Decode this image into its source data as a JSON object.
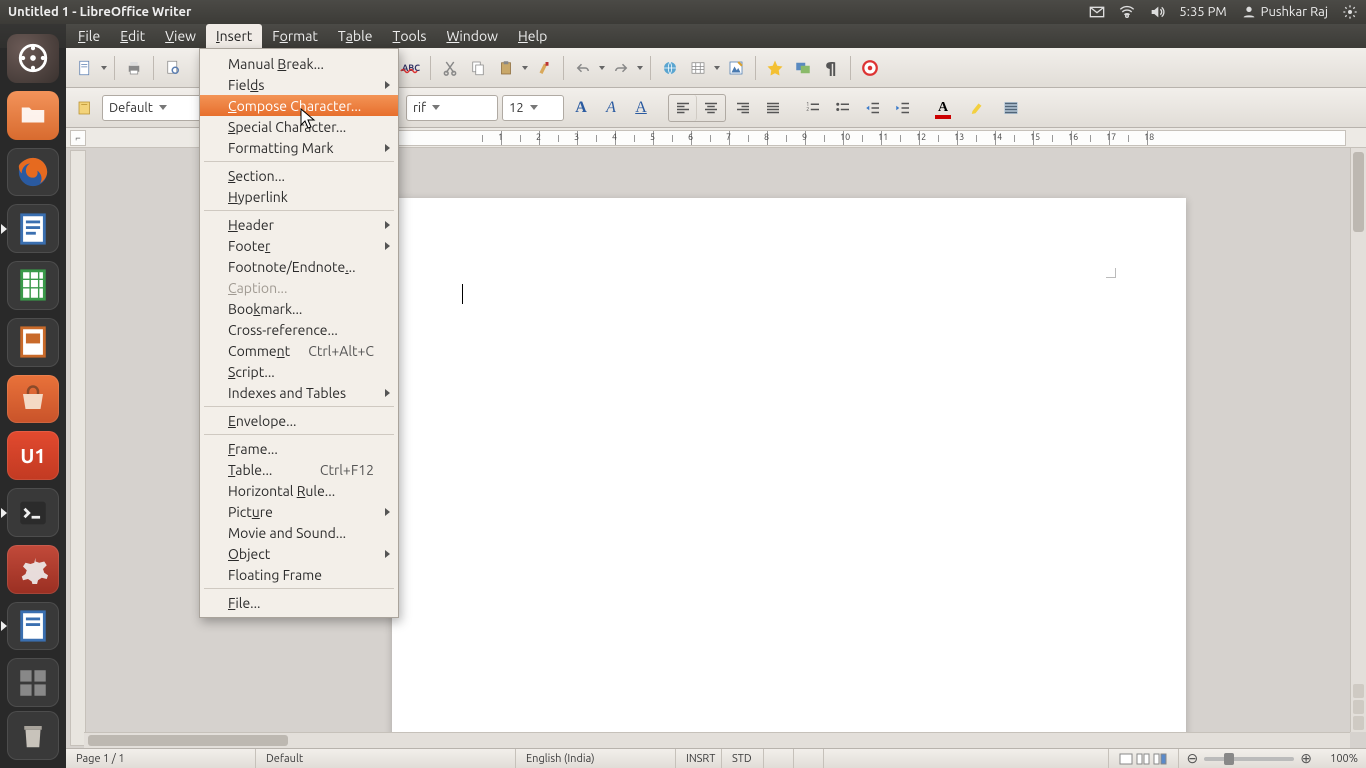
{
  "system": {
    "window_title": "Untitled 1 - LibreOffice Writer",
    "clock": "5:35 PM",
    "user": "Pushkar Raj"
  },
  "menubar": {
    "items": [
      {
        "label": "File",
        "mnemonic": "F"
      },
      {
        "label": "Edit",
        "mnemonic": "E"
      },
      {
        "label": "View",
        "mnemonic": "V"
      },
      {
        "label": "Insert",
        "mnemonic": "I",
        "open": true
      },
      {
        "label": "Format",
        "mnemonic": "o"
      },
      {
        "label": "Table",
        "mnemonic": "a"
      },
      {
        "label": "Tools",
        "mnemonic": "T"
      },
      {
        "label": "Window",
        "mnemonic": "W"
      },
      {
        "label": "Help",
        "mnemonic": "H"
      }
    ]
  },
  "insert_menu": {
    "groups": [
      [
        {
          "label": "Manual Break...",
          "mnemonic": "B"
        },
        {
          "label": "Fields",
          "mnemonic": "d",
          "submenu": true
        },
        {
          "label": "Compose Character...",
          "mnemonic": "C",
          "highlight": true
        },
        {
          "label": "Special Character...",
          "mnemonic": "S"
        },
        {
          "label": "Formatting Mark",
          "mnemonic": "g",
          "submenu": true
        }
      ],
      [
        {
          "label": "Section...",
          "mnemonic": "S"
        },
        {
          "label": "Hyperlink",
          "mnemonic": "H"
        }
      ],
      [
        {
          "label": "Header",
          "mnemonic": "H",
          "submenu": true
        },
        {
          "label": "Footer",
          "mnemonic": "r",
          "submenu": true
        },
        {
          "label": "Footnote/Endnote...",
          "mnemonic": "."
        },
        {
          "label": "Caption...",
          "mnemonic": "C",
          "disabled": true
        },
        {
          "label": "Bookmark...",
          "mnemonic": "k"
        },
        {
          "label": "Cross-reference..."
        },
        {
          "label": "Comment",
          "mnemonic": "n",
          "accel": "Ctrl+Alt+C"
        },
        {
          "label": "Script...",
          "mnemonic": "S"
        },
        {
          "label": "Indexes and Tables",
          "submenu": true
        }
      ],
      [
        {
          "label": "Envelope...",
          "mnemonic": "E"
        }
      ],
      [
        {
          "label": "Frame...",
          "mnemonic": "F"
        },
        {
          "label": "Table...",
          "mnemonic": "T",
          "accel": "Ctrl+F12"
        },
        {
          "label": "Horizontal Rule...",
          "mnemonic": "R"
        },
        {
          "label": "Picture",
          "mnemonic": "u",
          "submenu": true
        },
        {
          "label": "Movie and Sound..."
        },
        {
          "label": "Object",
          "mnemonic": "O",
          "submenu": true
        },
        {
          "label": "Floating Frame"
        }
      ],
      [
        {
          "label": "File...",
          "mnemonic": "F"
        }
      ]
    ]
  },
  "format": {
    "style": "Default",
    "font": "rif",
    "size": "12"
  },
  "status": {
    "page": "Page 1 / 1",
    "style": "Default",
    "language": "English (India)",
    "insert_mode": "INSRT",
    "selection_mode": "STD",
    "zoom": "100%"
  },
  "ruler": {
    "numbers": [
      1,
      2,
      3,
      4,
      5,
      6,
      7,
      8,
      9,
      10,
      11,
      12,
      13,
      14,
      15,
      16,
      17,
      18
    ]
  }
}
